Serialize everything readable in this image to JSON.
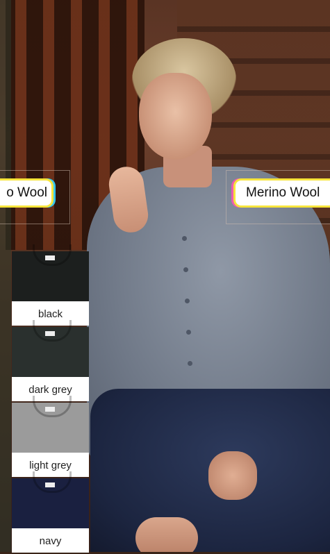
{
  "badges": {
    "left_label": "o Wool",
    "right_label": "Merino Wool"
  },
  "swatches": [
    {
      "label": "black",
      "color": "#1c1f1e"
    },
    {
      "label": "dark grey",
      "color": "#2a302e"
    },
    {
      "label": "light grey",
      "color": "#9b9b9b"
    },
    {
      "label": "navy",
      "color": "#1a2040"
    }
  ],
  "badge_colors": {
    "yellow": "#f7e53b",
    "cyan": "#35c6ef",
    "pink": "#ee5bb0"
  }
}
